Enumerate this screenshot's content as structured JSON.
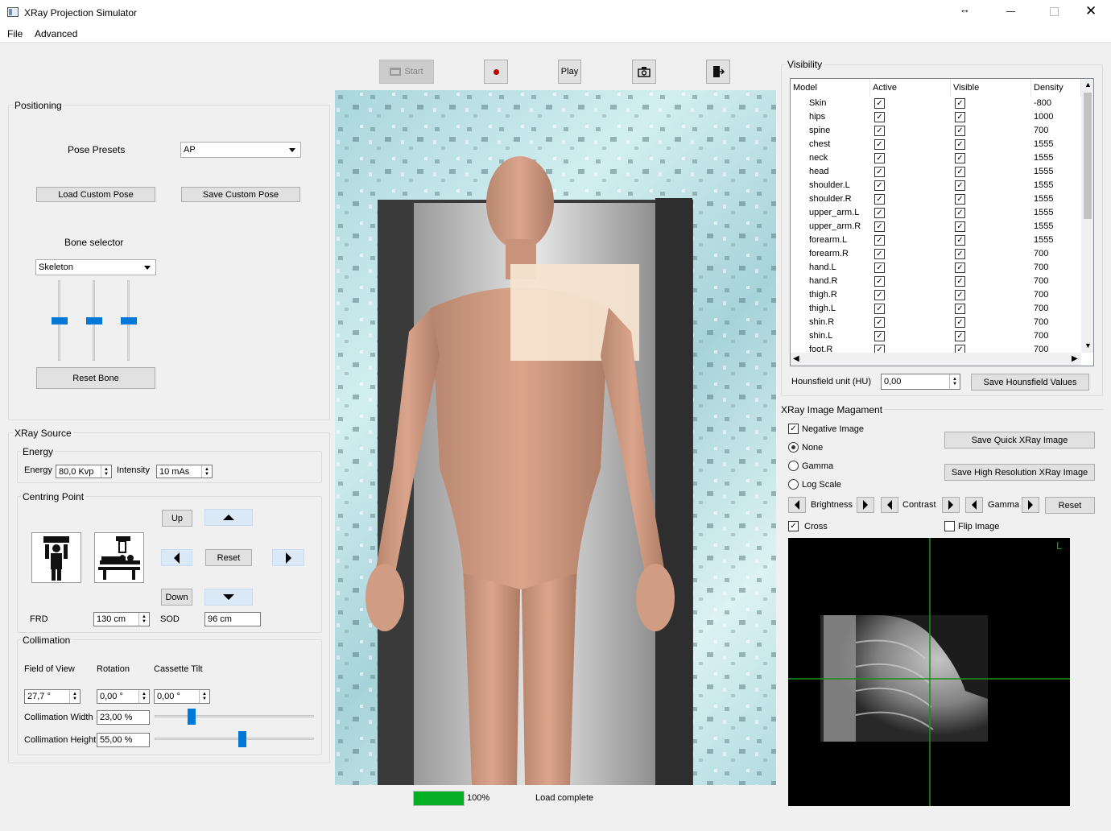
{
  "window": {
    "title": "XRay Projection Simulator"
  },
  "menu": [
    "File",
    "Advanced"
  ],
  "toolbar": {
    "start_label": "Start",
    "play_label": "Play"
  },
  "positioning": {
    "title": "Positioning",
    "pose_presets_label": "Pose Presets",
    "pose_value": "AP",
    "load_pose_label": "Load Custom Pose",
    "save_pose_label": "Save Custom Pose",
    "bone_selector_label": "Bone selector",
    "bone_value": "Skeleton",
    "reset_bone_label": "Reset Bone",
    "slider_levels": [
      0.5,
      0.5,
      0.5
    ]
  },
  "xray_source": {
    "title": "XRay Source",
    "energy_group": "Energy",
    "energy_label": "Energy",
    "energy_value": "80,0 Kvp",
    "intensity_label": "Intensity",
    "intensity_value": "10 mAs",
    "centring_group": "Centring Point",
    "up_label": "Up",
    "down_label": "Down",
    "reset_label": "Reset",
    "frd_label": "FRD",
    "frd_value": "130 cm",
    "sod_label": "SOD",
    "sod_value": "96 cm",
    "collimation_group": "Collimation",
    "fov_label": "Field of View",
    "rotation_label": "Rotation",
    "tilt_label": "Cassette Tilt",
    "fov_value": "27,7 °",
    "rotation_value": "0,00 °",
    "tilt_value": "0,00 °",
    "width_label": "Collimation Width",
    "width_value": "23,00 %",
    "height_label": "Collimation Height",
    "height_value": "55,00 %",
    "width_level": 0.23,
    "height_level": 0.55
  },
  "status": {
    "progress": 100,
    "progress_text": "100%",
    "message": "Load complete"
  },
  "visibility": {
    "title": "Visibility",
    "columns": [
      "Model",
      "Active",
      "Visible",
      "Density"
    ],
    "rows": [
      {
        "model": "Skin",
        "density": "-800"
      },
      {
        "model": "hips",
        "density": "1000"
      },
      {
        "model": "spine",
        "density": "700"
      },
      {
        "model": "chest",
        "density": "1555"
      },
      {
        "model": "neck",
        "density": "1555"
      },
      {
        "model": "head",
        "density": "1555"
      },
      {
        "model": "shoulder.L",
        "density": "1555"
      },
      {
        "model": "shoulder.R",
        "density": "1555"
      },
      {
        "model": "upper_arm.L",
        "density": "1555"
      },
      {
        "model": "upper_arm.R",
        "density": "1555"
      },
      {
        "model": "forearm.L",
        "density": "1555"
      },
      {
        "model": "forearm.R",
        "density": "700"
      },
      {
        "model": "hand.L",
        "density": "700"
      },
      {
        "model": "hand.R",
        "density": "700"
      },
      {
        "model": "thigh.R",
        "density": "700"
      },
      {
        "model": "thigh.L",
        "density": "700"
      },
      {
        "model": "shin.R",
        "density": "700"
      },
      {
        "model": "shin.L",
        "density": "700"
      },
      {
        "model": "foot.R",
        "density": "700"
      }
    ],
    "hu_label": "Hounsfield unit (HU)",
    "hu_value": "0,00",
    "save_hu_label": "Save Hounsfield Values"
  },
  "xray_image": {
    "title": "XRay Image Magament",
    "negative_label": "Negative Image",
    "none_label": "None",
    "gamma_label": "Gamma",
    "log_label": "Log Scale",
    "save_quick_label": "Save Quick XRay Image",
    "save_high_label": "Save High Resolution XRay Image",
    "brightness_label": "Brightness",
    "contrast_label": "Contrast",
    "gamma_adj_label": "Gamma",
    "reset_label": "Reset",
    "cross_label": "Cross",
    "flip_label": "Flip Image",
    "corner_marker": "L"
  }
}
